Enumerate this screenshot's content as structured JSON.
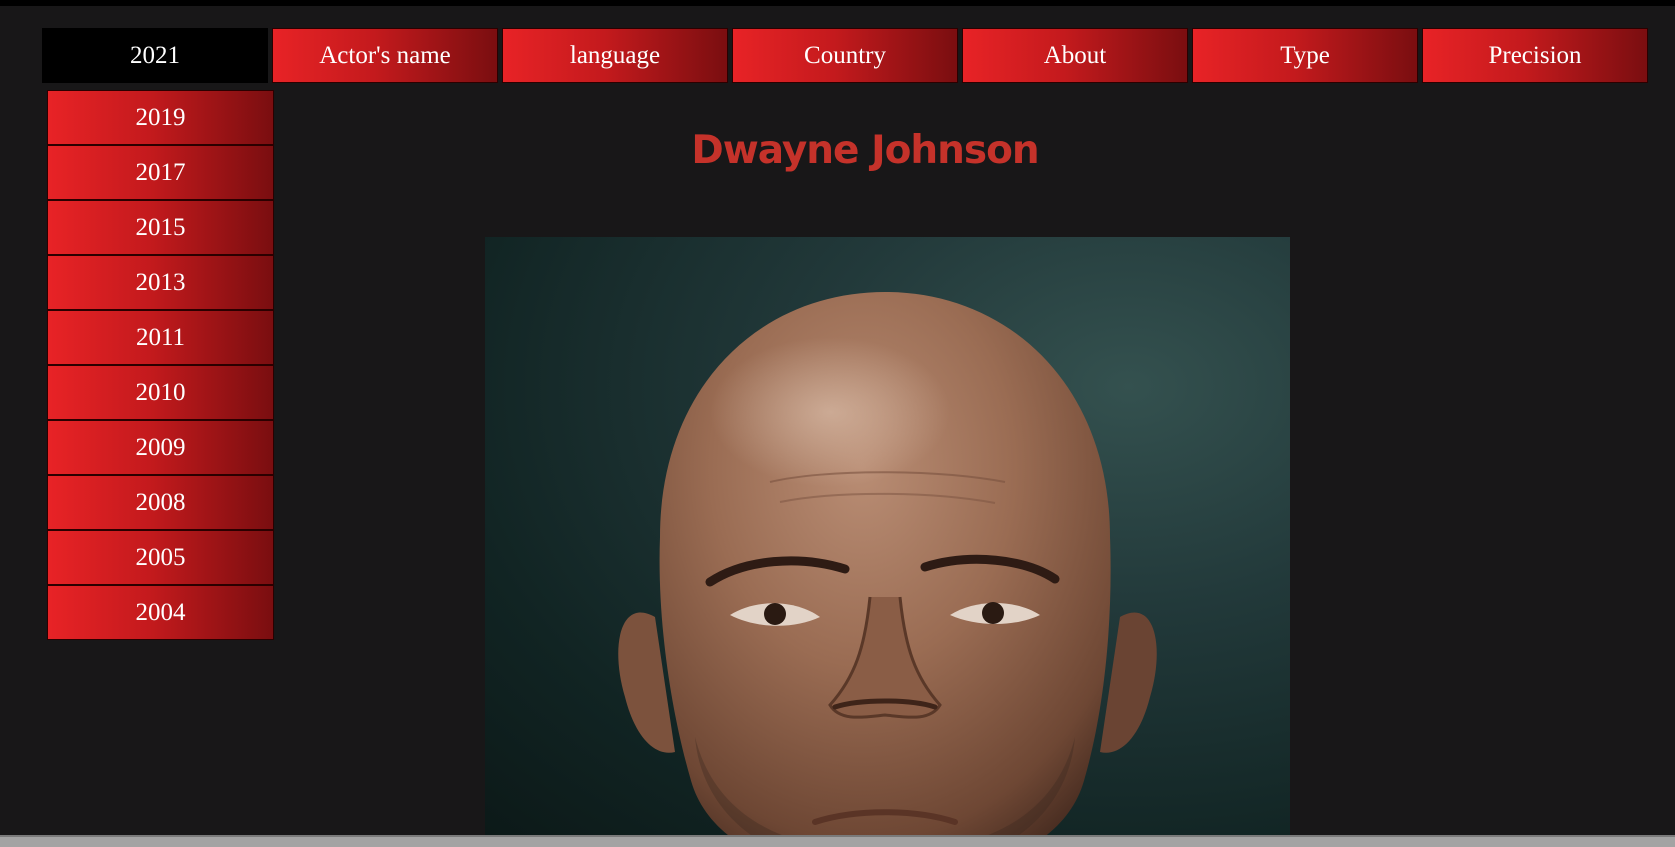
{
  "top_nav": {
    "tabs": [
      {
        "label": "2021",
        "active": true
      },
      {
        "label": "Actor's name",
        "active": false
      },
      {
        "label": "language",
        "active": false
      },
      {
        "label": "Country",
        "active": false
      },
      {
        "label": "About",
        "active": false
      },
      {
        "label": "Type",
        "active": false
      },
      {
        "label": "Precision",
        "active": false
      }
    ]
  },
  "year_menu": {
    "items": [
      "2019",
      "2017",
      "2015",
      "2013",
      "2011",
      "2010",
      "2009",
      "2008",
      "2005",
      "2004"
    ]
  },
  "main": {
    "title": "Dwayne Johnson",
    "photo_subject": "portrait-photo"
  },
  "colors": {
    "page_background": "#181718",
    "tab_red": "#e82326",
    "tab_dark_red": "#7a0e10",
    "title_red": "#c5322a",
    "active_tab": "#000000"
  }
}
